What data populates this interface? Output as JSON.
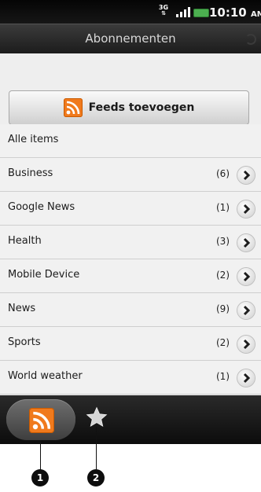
{
  "status_bar": {
    "network": "3G",
    "time": "10:10",
    "ampm": "AM"
  },
  "title_bar": {
    "title": "Abonnementen"
  },
  "add_feeds_button": {
    "label": "Feeds toevoegen",
    "icon": "rss-icon",
    "icon_color": "#f07a1d"
  },
  "all_items": {
    "label": "Alle items"
  },
  "feeds": [
    {
      "name": "Business",
      "count": "(6)"
    },
    {
      "name": "Google News",
      "count": "(1)"
    },
    {
      "name": "Health",
      "count": "(3)"
    },
    {
      "name": "Mobile Device",
      "count": "(2)"
    },
    {
      "name": "News",
      "count": "(9)"
    },
    {
      "name": "Sports",
      "count": "(2)"
    },
    {
      "name": "World weather",
      "count": "(1)"
    }
  ],
  "tabs": [
    {
      "icon": "rss-icon",
      "active": true
    },
    {
      "icon": "star-icon",
      "active": false
    }
  ],
  "callouts": [
    "1",
    "2"
  ]
}
